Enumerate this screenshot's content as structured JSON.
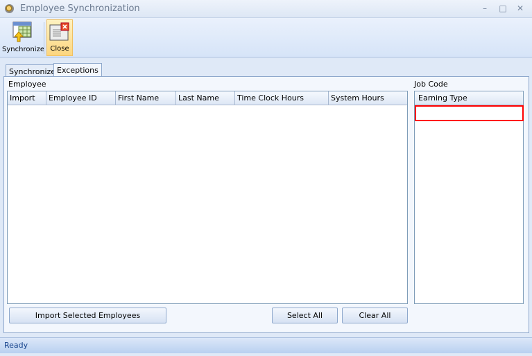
{
  "window": {
    "title": "Employee Synchronization",
    "minimize": "–",
    "maximize": "□",
    "close": "✕"
  },
  "toolbar": {
    "synchronize": "Synchronize",
    "close": "Close"
  },
  "tabs": [
    {
      "label": "Synchronize",
      "active": false
    },
    {
      "label": "Exceptions",
      "active": true
    }
  ],
  "employee": {
    "label": "Employee",
    "columns": [
      "Import",
      "Employee ID",
      "First Name",
      "Last Name",
      "Time Clock Hours",
      "System Hours"
    ],
    "rows": []
  },
  "job_code": {
    "label": "Job Code",
    "columns": [
      "Earning Type"
    ],
    "rows": []
  },
  "buttons": {
    "import": "Import Selected Employees",
    "select_all": "Select All",
    "clear_all": "Clear All"
  },
  "status": "Ready",
  "colors": {
    "highlight": "#ff0000",
    "accent": "#15428b"
  }
}
